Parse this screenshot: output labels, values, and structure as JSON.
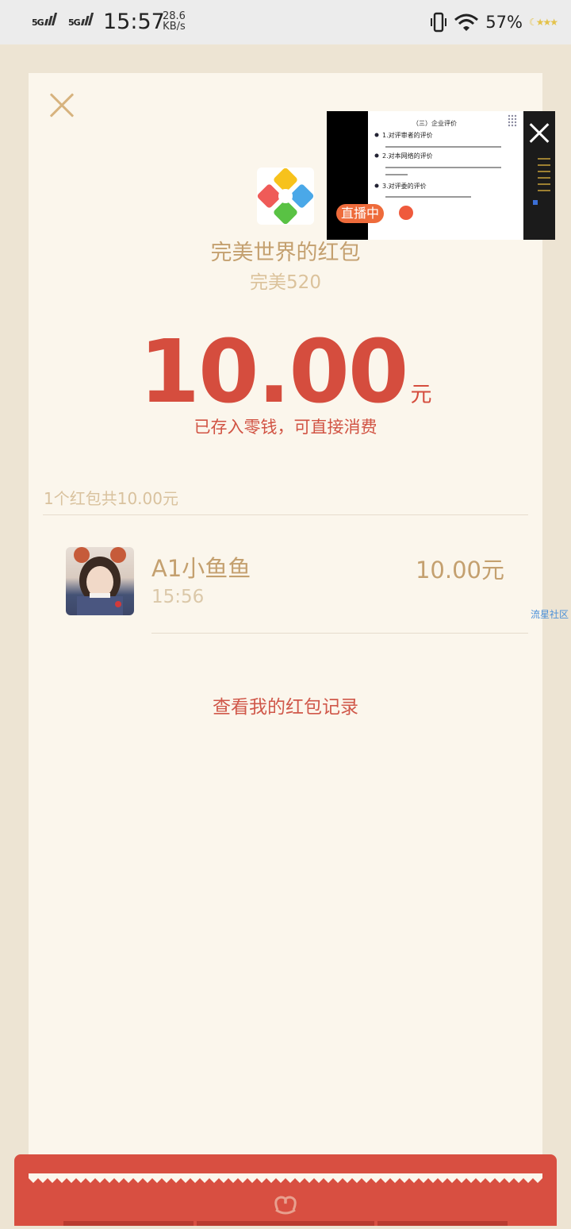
{
  "status_bar": {
    "signal1": "5G",
    "signal2": "5G",
    "time": "15:57",
    "net_speed_value": "28.6",
    "net_speed_unit": "KB/s",
    "battery": "57%"
  },
  "live_overlay": {
    "badge": "直播中",
    "slide_lines": [
      "（三）企业评价",
      "1.对评审者的评价",
      "2.对本网络的评价",
      "3.对评委的评价"
    ]
  },
  "red_packet": {
    "sender_title": "完美世界的红包",
    "wish": "完美520",
    "amount": "10.00",
    "amount_unit": "元",
    "stored_note": "已存入零钱，可直接消费"
  },
  "summary": "1个红包共10.00元",
  "receivers": [
    {
      "name": "A1小鱼鱼",
      "time": "15:56",
      "amount": "10.00元"
    }
  ],
  "watermark": "流星社区",
  "records_link": "查看我的红包记录",
  "colors": {
    "accent_red": "#d54d3e",
    "gold_text": "#c4a06f",
    "card_bg": "#fbf6ec",
    "page_bg": "#ede4d3"
  }
}
